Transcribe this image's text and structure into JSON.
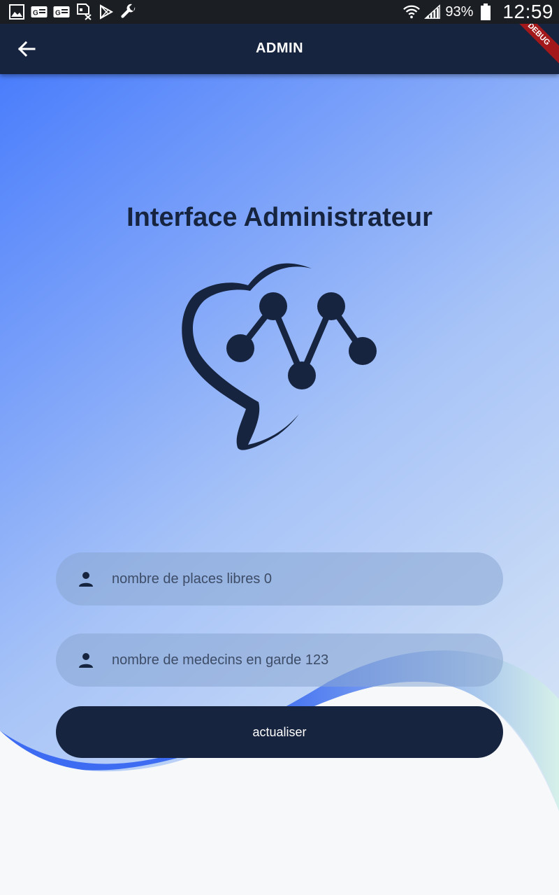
{
  "status_bar": {
    "battery_percent": "93%",
    "time": "12:59",
    "icons_left": [
      "gallery-icon",
      "id-card-icon",
      "id-card-icon",
      "sim-icon",
      "play-store-icon",
      "wrench-icon"
    ]
  },
  "appbar": {
    "title": "ADMIN",
    "debug_banner": "DEBUG"
  },
  "main": {
    "heading": "Interface Administrateur",
    "fields": [
      {
        "placeholder": "nombre de places libres 0",
        "value": "",
        "icon": "person-icon"
      },
      {
        "placeholder": "nombre de medecins en garde 123",
        "value": "",
        "icon": "person-icon"
      }
    ],
    "submit_label": "actualiser"
  },
  "colors": {
    "primary_dark": "#16243f",
    "gradient_start": "#4a7dfc",
    "gradient_end": "#d8e6f6",
    "status_bar": "#1b1f24"
  }
}
